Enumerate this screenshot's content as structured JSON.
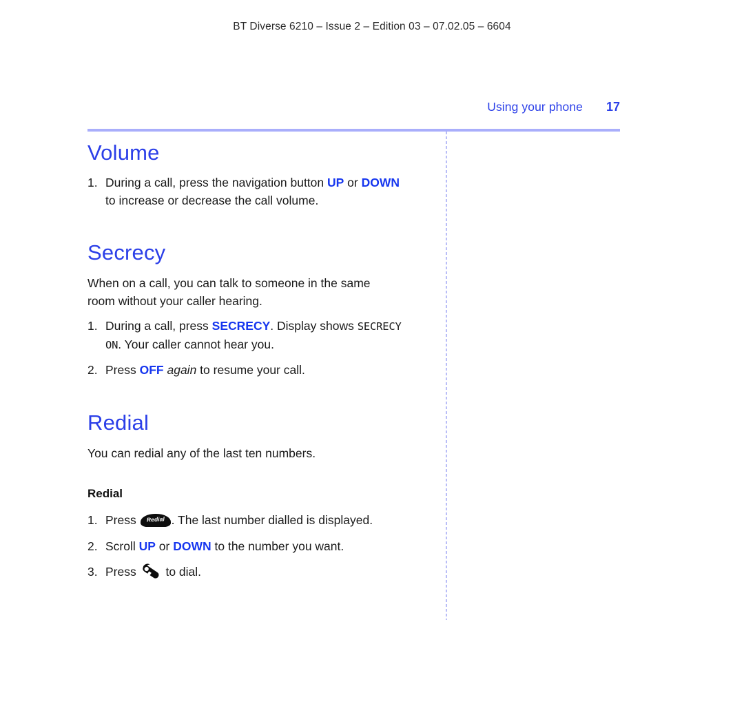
{
  "running_head": "BT Diverse 6210 – Issue 2 – Edition 03 – 07.02.05 – 6604",
  "page_header": {
    "section": "Using your phone",
    "folio": "17"
  },
  "colors": {
    "heading_blue": "#2b3fe8",
    "keyword_blue": "#1636ef",
    "rule_blue": "#a9aefb",
    "body_black": "#1a1a1a"
  },
  "sections": [
    {
      "title": "Volume",
      "steps": [
        {
          "num": "1.",
          "line1_a": "During a call, press the navigation button ",
          "key_up": "UP",
          "or": " or ",
          "key_down": "DOWN",
          "line2": "to increase or decrease the call volume."
        }
      ]
    },
    {
      "title": "Secrecy",
      "intro_line1": "When on a call, you can talk to someone in the same",
      "intro_line2": "room without your caller hearing.",
      "steps": [
        {
          "num": "1.",
          "text_a": "During a call, press ",
          "key": "SECRECY",
          "text_b": ". Display shows ",
          "display_1": "SECRECY",
          "display_2": "ON",
          "text_c": ". Your caller cannot hear you."
        },
        {
          "num": "2.",
          "text_a": "Press ",
          "key": "OFF",
          "emphasis": "again",
          "text_b": " to resume your call."
        }
      ]
    },
    {
      "title": "Redial",
      "intro": "You can redial any of the last ten numbers.",
      "subheading": "Redial",
      "steps": [
        {
          "num": "1.",
          "text_a": "Press ",
          "icon": "redial-key-icon",
          "icon_label": "Redial",
          "text_b": ". The last number dialled is displayed."
        },
        {
          "num": "2.",
          "text_a": "Scroll ",
          "key_up": "UP",
          "or": " or ",
          "key_down": "DOWN",
          "text_b": " to the number you want."
        },
        {
          "num": "3.",
          "text_a": "Press ",
          "icon": "dial-handset-icon",
          "text_b": " to dial."
        }
      ]
    }
  ]
}
